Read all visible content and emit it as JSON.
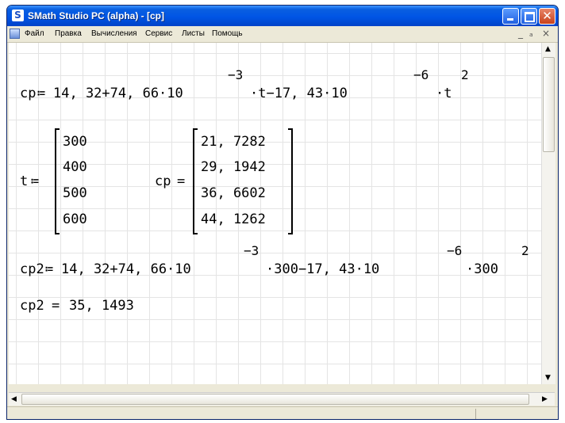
{
  "window": {
    "title": "SMath Studio PC (alpha) - [cp]",
    "app_icon": "smath-logo-icon",
    "controls": {
      "minimize_icon": "minimize-icon",
      "maximize_icon": "maximize-icon",
      "close_icon": "close-icon",
      "close_glyph": "✕"
    }
  },
  "menu": {
    "items": [
      "Файл",
      "Правка",
      "Вычисления",
      "Сервис",
      "Листы",
      "Помощь"
    ],
    "mdi_minimize": "_",
    "mdi_restore": "ₐ",
    "mdi_close": "×"
  },
  "worksheet": {
    "formula1": {
      "lhs": "cp",
      "assign": "≔",
      "part1": "14, 32+74, 66·10",
      "exp1": "−3",
      "part2": "·t−17, 43·10",
      "exp2": "−6",
      "part3": "·t",
      "exp3": "2"
    },
    "t_matrix": {
      "lhs": "t",
      "assign": "≔",
      "values": [
        "300",
        "400",
        "500",
        "600"
      ]
    },
    "cp_matrix": {
      "lhs": "cp",
      "equals": "=",
      "values": [
        "21, 7282",
        "29, 1942",
        "36, 6602",
        "44, 1262"
      ]
    },
    "formula2": {
      "lhs": "cp2",
      "assign": "≔",
      "part1": "14, 32+74, 66·10",
      "exp1": "−3",
      "part2": "·300−17, 43·10",
      "exp2": "−6",
      "part3": "·300",
      "exp3": "2"
    },
    "result": {
      "lhs": "cp2",
      "equals": "=",
      "value": "35, 1493"
    }
  },
  "scrollbars": {
    "up_arrow": "▲",
    "down_arrow": "▼",
    "left_arrow": "◀",
    "right_arrow": "▶"
  }
}
